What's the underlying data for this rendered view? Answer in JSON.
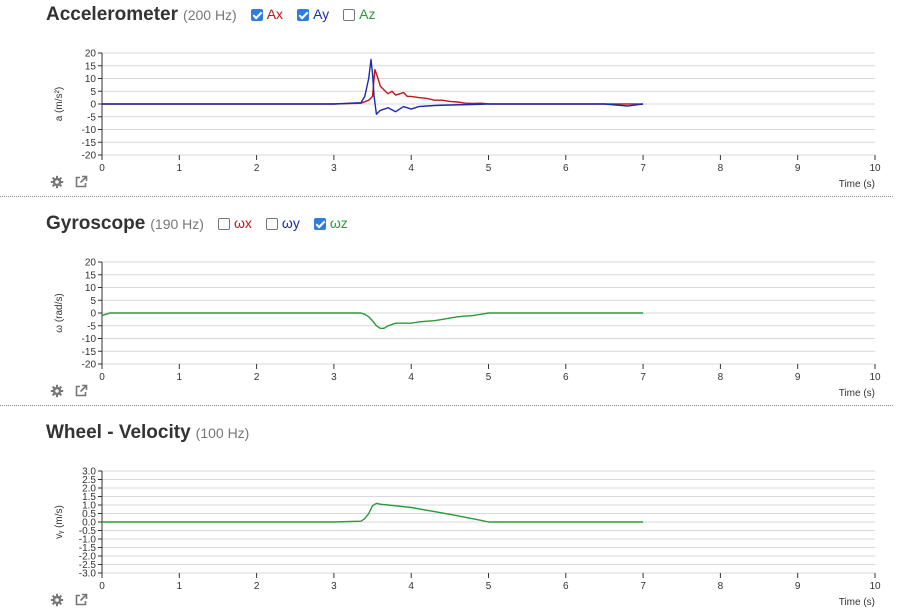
{
  "panels": [
    {
      "title": "Accelerometer",
      "rate": "(200 Hz)",
      "toggles": [
        {
          "label": "Ax",
          "checked": true,
          "color": "#c0161c"
        },
        {
          "label": "Ay",
          "checked": true,
          "color": "#1b2bb0"
        },
        {
          "label": "Az",
          "checked": false,
          "color": "#2a9a3a"
        }
      ],
      "ylabel": "a (m/s²)",
      "xlabel": "Time (s)"
    },
    {
      "title": "Gyroscope",
      "rate": "(190 Hz)",
      "toggles": [
        {
          "label": "ωx",
          "checked": false,
          "color": "#c0161c"
        },
        {
          "label": "ωy",
          "checked": false,
          "color": "#1b2bb0"
        },
        {
          "label": "ωz",
          "checked": true,
          "color": "#2a9a3a"
        }
      ],
      "ylabel": "ω (rad/s)",
      "xlabel": "Time (s)"
    },
    {
      "title": "Wheel - Velocity",
      "rate": "(100 Hz)",
      "toggles": [],
      "ylabel": "vᵧ (m/s)",
      "xlabel": "Time (s)"
    }
  ],
  "icons": [
    "gear-icon",
    "external-link-icon"
  ],
  "chart_data": [
    {
      "type": "line",
      "title": "Accelerometer",
      "xlabel": "Time (s)",
      "ylabel": "a (m/s²)",
      "xlim": [
        0,
        10
      ],
      "ylim": [
        -20,
        20
      ],
      "xticks": [
        0,
        1,
        2,
        3,
        4,
        5,
        6,
        7,
        8,
        9,
        10
      ],
      "yticks": [
        20,
        15,
        10,
        5,
        0,
        -5,
        -10,
        -15,
        -20
      ],
      "grid": true,
      "series": [
        {
          "name": "Ax",
          "color": "#c0161c",
          "x": [
            0,
            1,
            2,
            3,
            3.35,
            3.45,
            3.5,
            3.53,
            3.56,
            3.6,
            3.65,
            3.7,
            3.75,
            3.8,
            3.85,
            3.9,
            3.95,
            4,
            4.1,
            4.2,
            4.3,
            4.4,
            4.5,
            4.6,
            4.7,
            4.8,
            4.9,
            5,
            5.5,
            6,
            6.5,
            7
          ],
          "y": [
            0,
            0,
            0,
            0,
            0.3,
            1.5,
            3,
            13.5,
            11,
            7,
            5.5,
            4,
            5,
            3.5,
            4,
            4.5,
            3,
            3,
            2.5,
            2.2,
            1.5,
            1.5,
            1,
            0.8,
            0.3,
            0.2,
            0.3,
            0,
            0,
            0,
            0,
            0
          ]
        },
        {
          "name": "Ay",
          "color": "#1b2bb0",
          "x": [
            0,
            1,
            2,
            3,
            3.35,
            3.4,
            3.45,
            3.48,
            3.5,
            3.52,
            3.55,
            3.6,
            3.7,
            3.8,
            3.9,
            4,
            4.1,
            4.2,
            4.3,
            4.5,
            4.8,
            5,
            5.5,
            6,
            6.5,
            6.8,
            7
          ],
          "y": [
            0,
            0,
            0,
            0,
            0.5,
            3,
            10,
            17.5,
            12,
            3,
            -4,
            -2.5,
            -1.5,
            -3,
            -1,
            -2,
            -1,
            -0.8,
            -0.6,
            -0.4,
            -0.2,
            0,
            0,
            0,
            0,
            -0.8,
            0
          ]
        },
        {
          "name": "Az",
          "color": "#2a9a3a",
          "x": [],
          "y": []
        }
      ]
    },
    {
      "type": "line",
      "title": "Gyroscope",
      "xlabel": "Time (s)",
      "ylabel": "ω (rad/s)",
      "xlim": [
        0,
        10
      ],
      "ylim": [
        -20,
        20
      ],
      "xticks": [
        0,
        1,
        2,
        3,
        4,
        5,
        6,
        7,
        8,
        9,
        10
      ],
      "yticks": [
        20,
        15,
        10,
        5,
        0,
        -5,
        -10,
        -15,
        -20
      ],
      "grid": true,
      "series": [
        {
          "name": "ωx",
          "color": "#c0161c",
          "x": [],
          "y": []
        },
        {
          "name": "ωy",
          "color": "#1b2bb0",
          "x": [],
          "y": []
        },
        {
          "name": "ωz",
          "color": "#2a9a3a",
          "x": [
            0,
            0.05,
            0.1,
            0.5,
            1,
            2,
            3,
            3.35,
            3.4,
            3.45,
            3.5,
            3.55,
            3.6,
            3.65,
            3.7,
            3.8,
            3.9,
            4,
            4.1,
            4.2,
            4.3,
            4.4,
            4.5,
            4.6,
            4.7,
            4.8,
            4.9,
            5,
            5.5,
            6,
            6.5,
            7
          ],
          "y": [
            -1,
            -0.5,
            0,
            0,
            0,
            0,
            0,
            0,
            -0.5,
            -1.5,
            -3,
            -5,
            -6,
            -6,
            -5,
            -4,
            -4,
            -4,
            -3.5,
            -3.2,
            -3,
            -2.5,
            -2,
            -1.5,
            -1.2,
            -1,
            -0.5,
            0,
            0,
            0,
            0,
            0
          ]
        }
      ]
    },
    {
      "type": "line",
      "title": "Wheel - Velocity",
      "xlabel": "Time (s)",
      "ylabel": "vᵧ (m/s)",
      "xlim": [
        0,
        10
      ],
      "ylim": [
        -3,
        3
      ],
      "xticks": [
        0,
        1,
        2,
        3,
        4,
        5,
        6,
        7,
        8,
        9,
        10
      ],
      "yticks": [
        3.0,
        2.5,
        2.0,
        1.5,
        1.0,
        0.5,
        0.0,
        -0.5,
        -1.0,
        -1.5,
        -2.0,
        -2.5,
        -3.0
      ],
      "grid": true,
      "series": [
        {
          "name": "vᵧ",
          "color": "#2a9a3a",
          "x": [
            0,
            3,
            3.35,
            3.4,
            3.45,
            3.5,
            3.55,
            3.6,
            3.7,
            3.8,
            4,
            4.5,
            4.9,
            5,
            5.5,
            6,
            7
          ],
          "y": [
            0,
            0,
            0.05,
            0.2,
            0.5,
            0.95,
            1.1,
            1.05,
            1.0,
            0.95,
            0.85,
            0.45,
            0.1,
            0,
            0,
            0,
            0
          ]
        }
      ]
    }
  ]
}
